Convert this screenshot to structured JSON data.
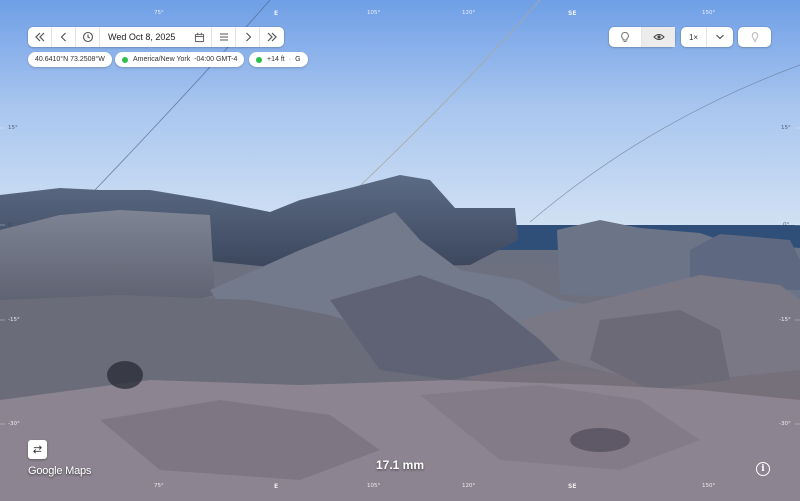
{
  "toolbar": {
    "date": "Wed Oct 8, 2025",
    "icons": [
      "skip-back-icon",
      "step-back-icon",
      "clock-icon",
      "calendar-icon",
      "menu-icon",
      "step-forward-icon",
      "skip-forward-icon"
    ]
  },
  "status": {
    "coords": "40.6410°N 73.2508°W",
    "timezone": "America/New York",
    "offset": "-04:00 GMT-4",
    "elevation": "+14 ft",
    "elevation_ref": "G"
  },
  "view_controls": {
    "speed": "1×",
    "icons": [
      "lightbulb-icon",
      "eye-icon",
      "chevron-down-icon",
      "pin-icon"
    ]
  },
  "top_axis": [
    "75°",
    "E",
    "105°",
    "120°",
    "SE",
    "150°"
  ],
  "bottom_axis": [
    "75°",
    "E",
    "105°",
    "120°",
    "SE",
    "150°"
  ],
  "left_axis": [
    "15°",
    "0°",
    "-15°",
    "-30°"
  ],
  "right_axis": [
    "15°",
    "0°",
    "-15°",
    "-30°"
  ],
  "scale_label": "17.1 mm",
  "brand": "Google Maps",
  "colors": {
    "sky_top": "#6f9fe6",
    "sky_horizon": "#cfe0f3",
    "status_dot": "#2dbe4e"
  }
}
